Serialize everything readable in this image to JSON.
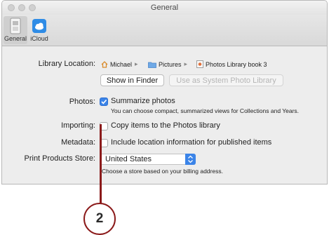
{
  "window": {
    "title": "General"
  },
  "toolbar": {
    "tabs": [
      {
        "label": "General",
        "icon": "general-switch-icon",
        "active": true
      },
      {
        "label": "iCloud",
        "icon": "icloud-icon",
        "active": false
      }
    ]
  },
  "library": {
    "label": "Library Location:",
    "path": [
      "Michael",
      "Pictures",
      "Photos Library book 3"
    ],
    "show_in_finder": "Show in Finder",
    "use_as_system": "Use as System Photo Library"
  },
  "photos": {
    "label": "Photos:",
    "checkbox_label": "Summarize photos",
    "checked": true,
    "help": "You can choose compact, summarized views for Collections and Years."
  },
  "importing": {
    "label": "Importing:",
    "checkbox_label": "Copy items to the Photos library",
    "checked": false
  },
  "metadata": {
    "label": "Metadata:",
    "checkbox_label": "Include location information for published items",
    "checked": false
  },
  "print": {
    "label": "Print Products Store:",
    "selected": "United States",
    "help": "Choose a store based on your billing address."
  },
  "callout": {
    "number": "2"
  },
  "colors": {
    "accent": "#3b84e8",
    "callout": "#8b1a1a"
  }
}
